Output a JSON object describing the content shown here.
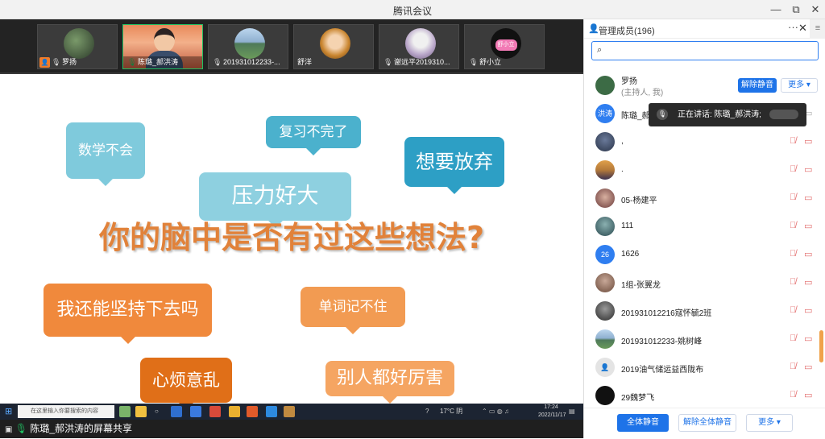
{
  "window": {
    "title": "腾讯会议",
    "controls": {
      "minimize": "—",
      "restore": "⧉",
      "close": "✕"
    }
  },
  "video_strip": {
    "tiles": [
      {
        "name": "罗扬",
        "host": true,
        "mic": "muted"
      },
      {
        "name": "陈璐_郝洪涛",
        "host": false,
        "mic": "speaking"
      },
      {
        "name": "201931012233-...",
        "host": false,
        "mic": "muted"
      },
      {
        "name": "舒洋",
        "host": false,
        "mic": "none"
      },
      {
        "name": "谢远平2019310...",
        "host": false,
        "mic": "muted"
      },
      {
        "name": "舒小立",
        "host": false,
        "mic": "muted"
      }
    ],
    "tile5_avatar_text": "舒小立"
  },
  "slide": {
    "bubbles": [
      {
        "text": "数学不会",
        "color": "#7fcadc"
      },
      {
        "text": "复习不完了",
        "color": "#4bb1cd"
      },
      {
        "text": "想要放弃",
        "color": "#2d9fc5"
      },
      {
        "text": "压力好大",
        "color": "#8ed0e0"
      },
      {
        "text": "我还能坚持下去吗",
        "color": "#f0893c"
      },
      {
        "text": "单词记不住",
        "color": "#f29b52"
      },
      {
        "text": "心烦意乱",
        "color": "#e06f18"
      },
      {
        "text": "别人都好厉害",
        "color": "#f5a562"
      }
    ],
    "headline": "你的脑中是否有过这些想法?"
  },
  "taskbar": {
    "search_placeholder": "在这里输入你要搜索的内容",
    "weather": "17°C 阴",
    "time": "17:24",
    "date": "2022/11/17"
  },
  "share_bar": {
    "label": "陈璐_郝洪涛的屏幕共享"
  },
  "panel": {
    "title": "管理成员(196)",
    "more": "···",
    "close": "✕",
    "side_toggle": "≡",
    "search_value": "",
    "speaking_tip": "正在讲话: 陈璐_郝洪涛;",
    "members": [
      {
        "name": "罗扬",
        "sub": "(主持人, 我)",
        "avatar": "",
        "avatar_color": "#3c6b45",
        "actions": [
          "解除静音",
          "更多"
        ]
      },
      {
        "name": "陈璐_郝",
        "avatar": "洪涛",
        "avatar_color": "#2f7ef0"
      },
      {
        "name": ",",
        "avatar": "",
        "avatar_color": "#3f4f6a"
      },
      {
        "name": ".",
        "avatar": "",
        "avatar_color": "#b57a3a"
      },
      {
        "name": "05-杨建平",
        "avatar": "",
        "avatar_color": "#8a5a5a"
      },
      {
        "name": "111",
        "avatar": "",
        "avatar_color": "#3c6b6e"
      },
      {
        "name": "1626",
        "avatar": "26",
        "avatar_color": "#2f7ef0"
      },
      {
        "name": "1组-张翼龙",
        "avatar": "",
        "avatar_color": "#9a7a6a"
      },
      {
        "name": "201931012216寇怀毓2班",
        "avatar": "",
        "avatar_color": "#4a4a4a"
      },
      {
        "name": "201931012233-姚树峰",
        "avatar": "",
        "avatar_color": "#4f7a5a"
      },
      {
        "name": "2019油气储运益西陇布",
        "avatar": "",
        "avatar_color": "#dcdcdc"
      },
      {
        "name": "29魏梦飞",
        "avatar": "",
        "avatar_color": "#111111"
      }
    ],
    "footer": {
      "mute_all": "全体静音",
      "unmute_all": "解除全体静音",
      "more": "更多"
    }
  },
  "colors": {
    "accent": "#1e73e8",
    "headline": "#e1823a",
    "muted_icon": "#e26a6a",
    "speaking_green": "#20c062"
  }
}
